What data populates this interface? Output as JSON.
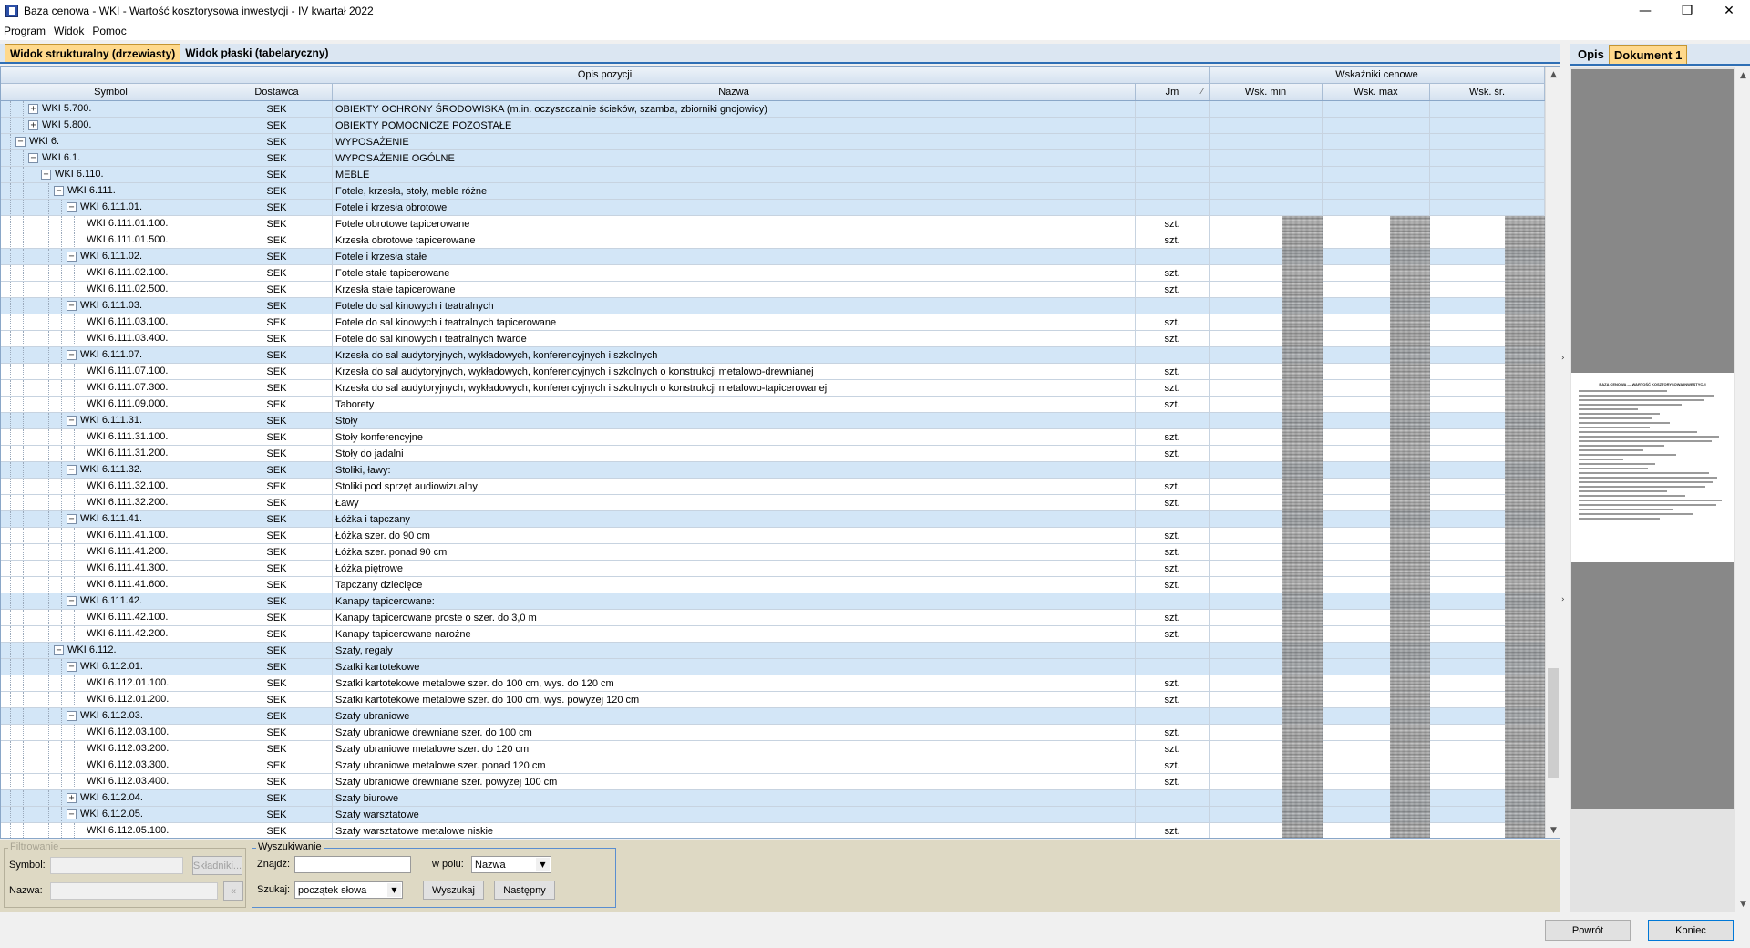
{
  "window": {
    "title": "Baza cenowa - WKI - Wartość kosztorysowa inwestycji - IV kwartał 2022",
    "minimize": "—",
    "maximize": "❐",
    "close": "✕"
  },
  "menu": [
    "Program",
    "Widok",
    "Pomoc"
  ],
  "tabs": {
    "structural": "Widok strukturalny (drzewiasty)",
    "flat": "Widok płaski (tabelaryczny)"
  },
  "grid": {
    "group_headers": {
      "description": "Opis pozycji",
      "indicators": "Wskaźniki cenowe"
    },
    "columns": {
      "symbol": "Symbol",
      "supplier": "Dostawca",
      "name": "Nazwa",
      "unit": "Jm",
      "min": "Wsk. min",
      "max": "Wsk. max",
      "avg": "Wsk. śr."
    },
    "rows": [
      {
        "symbol": "WKI 5.700.",
        "level": 1,
        "exp": "+",
        "dost": "SEK",
        "name": "OBIEKTY OCHRONY ŚRODOWISKA (m.in. oczyszczalnie ścieków, szamba, zbiorniki gnojowicy)",
        "jm": "",
        "group": true
      },
      {
        "symbol": "WKI 5.800.",
        "level": 1,
        "exp": "+",
        "dost": "SEK",
        "name": "OBIEKTY POMOCNICZE POZOSTAŁE",
        "jm": "",
        "group": true
      },
      {
        "symbol": "WKI 6.",
        "level": 0,
        "exp": "−",
        "dost": "SEK",
        "name": "WYPOSAŻENIE",
        "jm": "",
        "group": true
      },
      {
        "symbol": "WKI 6.1.",
        "level": 1,
        "exp": "−",
        "dost": "SEK",
        "name": "WYPOSAŻENIE OGÓLNE",
        "jm": "",
        "group": true
      },
      {
        "symbol": "WKI 6.110.",
        "level": 2,
        "exp": "−",
        "dost": "SEK",
        "name": "MEBLE",
        "jm": "",
        "group": true
      },
      {
        "symbol": "WKI 6.111.",
        "level": 3,
        "exp": "−",
        "dost": "SEK",
        "name": "Fotele, krzesła, stoły, meble różne",
        "jm": "",
        "group": true
      },
      {
        "symbol": "WKI 6.111.01.",
        "level": 4,
        "exp": "−",
        "dost": "SEK",
        "name": "Fotele i krzesła obrotowe",
        "jm": "",
        "group": true
      },
      {
        "symbol": "WKI 6.111.01.100.",
        "level": 5,
        "exp": "",
        "dost": "SEK",
        "name": "Fotele obrotowe tapicerowane",
        "jm": "szt.",
        "group": false
      },
      {
        "symbol": "WKI 6.111.01.500.",
        "level": 5,
        "exp": "",
        "dost": "SEK",
        "name": "Krzesła obrotowe tapicerowane",
        "jm": "szt.",
        "group": false
      },
      {
        "symbol": "WKI 6.111.02.",
        "level": 4,
        "exp": "−",
        "dost": "SEK",
        "name": "Fotele i krzesła stałe",
        "jm": "",
        "group": true
      },
      {
        "symbol": "WKI 6.111.02.100.",
        "level": 5,
        "exp": "",
        "dost": "SEK",
        "name": "Fotele stałe tapicerowane",
        "jm": "szt.",
        "group": false
      },
      {
        "symbol": "WKI 6.111.02.500.",
        "level": 5,
        "exp": "",
        "dost": "SEK",
        "name": "Krzesła stałe tapicerowane",
        "jm": "szt.",
        "group": false
      },
      {
        "symbol": "WKI 6.111.03.",
        "level": 4,
        "exp": "−",
        "dost": "SEK",
        "name": "Fotele do sal kinowych i teatralnych",
        "jm": "",
        "group": true
      },
      {
        "symbol": "WKI 6.111.03.100.",
        "level": 5,
        "exp": "",
        "dost": "SEK",
        "name": "Fotele do sal kinowych i teatralnych tapicerowane",
        "jm": "szt.",
        "group": false
      },
      {
        "symbol": "WKI 6.111.03.400.",
        "level": 5,
        "exp": "",
        "dost": "SEK",
        "name": "Fotele do sal kinowych i teatralnych twarde",
        "jm": "szt.",
        "group": false
      },
      {
        "symbol": "WKI 6.111.07.",
        "level": 4,
        "exp": "−",
        "dost": "SEK",
        "name": "Krzesła do sal audytoryjnych, wykładowych, konferencyjnych i szkolnych",
        "jm": "",
        "group": true
      },
      {
        "symbol": "WKI 6.111.07.100.",
        "level": 5,
        "exp": "",
        "dost": "SEK",
        "name": "Krzesła do sal audytoryjnych, wykładowych, konferencyjnych i szkolnych o konstrukcji metalowo-drewnianej",
        "jm": "szt.",
        "group": false
      },
      {
        "symbol": "WKI 6.111.07.300.",
        "level": 5,
        "exp": "",
        "dost": "SEK",
        "name": "Krzesła do sal audytoryjnych, wykładowych, konferencyjnych i szkolnych o konstrukcji metalowo-tapicerowanej",
        "jm": "szt.",
        "group": false
      },
      {
        "symbol": "WKI 6.111.09.000.",
        "level": 5,
        "exp": "",
        "dost": "SEK",
        "name": "Taborety",
        "jm": "szt.",
        "group": false
      },
      {
        "symbol": "WKI 6.111.31.",
        "level": 4,
        "exp": "−",
        "dost": "SEK",
        "name": "Stoły",
        "jm": "",
        "group": true
      },
      {
        "symbol": "WKI 6.111.31.100.",
        "level": 5,
        "exp": "",
        "dost": "SEK",
        "name": "Stoły konferencyjne",
        "jm": "szt.",
        "group": false
      },
      {
        "symbol": "WKI 6.111.31.200.",
        "level": 5,
        "exp": "",
        "dost": "SEK",
        "name": "Stoły do jadalni",
        "jm": "szt.",
        "group": false
      },
      {
        "symbol": "WKI 6.111.32.",
        "level": 4,
        "exp": "−",
        "dost": "SEK",
        "name": "Stoliki, ławy:",
        "jm": "",
        "group": true
      },
      {
        "symbol": "WKI 6.111.32.100.",
        "level": 5,
        "exp": "",
        "dost": "SEK",
        "name": "Stoliki pod sprzęt audiowizualny",
        "jm": "szt.",
        "group": false
      },
      {
        "symbol": "WKI 6.111.32.200.",
        "level": 5,
        "exp": "",
        "dost": "SEK",
        "name": "Ławy",
        "jm": "szt.",
        "group": false
      },
      {
        "symbol": "WKI 6.111.41.",
        "level": 4,
        "exp": "−",
        "dost": "SEK",
        "name": "Łóżka i tapczany",
        "jm": "",
        "group": true
      },
      {
        "symbol": "WKI 6.111.41.100.",
        "level": 5,
        "exp": "",
        "dost": "SEK",
        "name": "Łóżka szer. do 90 cm",
        "jm": "szt.",
        "group": false
      },
      {
        "symbol": "WKI 6.111.41.200.",
        "level": 5,
        "exp": "",
        "dost": "SEK",
        "name": "Łóżka szer. ponad 90 cm",
        "jm": "szt.",
        "group": false
      },
      {
        "symbol": "WKI 6.111.41.300.",
        "level": 5,
        "exp": "",
        "dost": "SEK",
        "name": "Łóżka piętrowe",
        "jm": "szt.",
        "group": false
      },
      {
        "symbol": "WKI 6.111.41.600.",
        "level": 5,
        "exp": "",
        "dost": "SEK",
        "name": "Tapczany dziecięce",
        "jm": "szt.",
        "group": false
      },
      {
        "symbol": "WKI 6.111.42.",
        "level": 4,
        "exp": "−",
        "dost": "SEK",
        "name": "Kanapy tapicerowane:",
        "jm": "",
        "group": true
      },
      {
        "symbol": "WKI 6.111.42.100.",
        "level": 5,
        "exp": "",
        "dost": "SEK",
        "name": "Kanapy tapicerowane proste o szer. do 3,0 m",
        "jm": "szt.",
        "group": false
      },
      {
        "symbol": "WKI 6.111.42.200.",
        "level": 5,
        "exp": "",
        "dost": "SEK",
        "name": "Kanapy tapicerowane narożne",
        "jm": "szt.",
        "group": false
      },
      {
        "symbol": "WKI 6.112.",
        "level": 3,
        "exp": "−",
        "dost": "SEK",
        "name": "Szafy, regały",
        "jm": "",
        "group": true
      },
      {
        "symbol": "WKI 6.112.01.",
        "level": 4,
        "exp": "−",
        "dost": "SEK",
        "name": "Szafki kartotekowe",
        "jm": "",
        "group": true
      },
      {
        "symbol": "WKI 6.112.01.100.",
        "level": 5,
        "exp": "",
        "dost": "SEK",
        "name": "Szafki kartotekowe metalowe szer. do 100 cm, wys. do 120 cm",
        "jm": "szt.",
        "group": false
      },
      {
        "symbol": "WKI 6.112.01.200.",
        "level": 5,
        "exp": "",
        "dost": "SEK",
        "name": "Szafki kartotekowe metalowe szer. do 100 cm, wys. powyżej 120 cm",
        "jm": "szt.",
        "group": false
      },
      {
        "symbol": "WKI 6.112.03.",
        "level": 4,
        "exp": "−",
        "dost": "SEK",
        "name": "Szafy ubraniowe",
        "jm": "",
        "group": true
      },
      {
        "symbol": "WKI 6.112.03.100.",
        "level": 5,
        "exp": "",
        "dost": "SEK",
        "name": "Szafy ubraniowe drewniane szer. do 100 cm",
        "jm": "szt.",
        "group": false
      },
      {
        "symbol": "WKI 6.112.03.200.",
        "level": 5,
        "exp": "",
        "dost": "SEK",
        "name": "Szafy ubraniowe metalowe szer. do 120 cm",
        "jm": "szt.",
        "group": false
      },
      {
        "symbol": "WKI 6.112.03.300.",
        "level": 5,
        "exp": "",
        "dost": "SEK",
        "name": "Szafy ubraniowe metalowe szer. ponad 120 cm",
        "jm": "szt.",
        "group": false
      },
      {
        "symbol": "WKI 6.112.03.400.",
        "level": 5,
        "exp": "",
        "dost": "SEK",
        "name": "Szafy ubraniowe drewniane szer. powyżej 100 cm",
        "jm": "szt.",
        "group": false
      },
      {
        "symbol": "WKI 6.112.04.",
        "level": 4,
        "exp": "+",
        "dost": "SEK",
        "name": "Szafy biurowe",
        "jm": "",
        "group": true
      },
      {
        "symbol": "WKI 6.112.05.",
        "level": 4,
        "exp": "−",
        "dost": "SEK",
        "name": "Szafy warsztatowe",
        "jm": "",
        "group": true
      },
      {
        "symbol": "WKI 6.112.05.100.",
        "level": 5,
        "exp": "",
        "dost": "SEK",
        "name": "Szafy warsztatowe metalowe niskie",
        "jm": "szt.",
        "group": false
      }
    ]
  },
  "right_panel": {
    "tabs": {
      "opis": "Opis",
      "doc": "Dokument 1"
    },
    "doc_title": "BAZA CENOWA — WARTOŚĆ KOSZTORYSOWA INWESTYCJI"
  },
  "filter": {
    "legend": "Filtrowanie",
    "symbol_label": "Symbol:",
    "name_label": "Nazwa:",
    "components_button": "Składniki...",
    "clear_button": "«"
  },
  "search": {
    "legend": "Wyszukiwanie",
    "find_label": "Znajdź:",
    "find_value": "",
    "field_label": "w polu:",
    "field_value": "Nazwa",
    "mode_label": "Szukaj:",
    "mode_value": "początek słowa",
    "search_button": "Wyszukaj",
    "next_button": "Następny"
  },
  "footer": {
    "back_button": "Powrót",
    "end_button": "Koniec"
  }
}
